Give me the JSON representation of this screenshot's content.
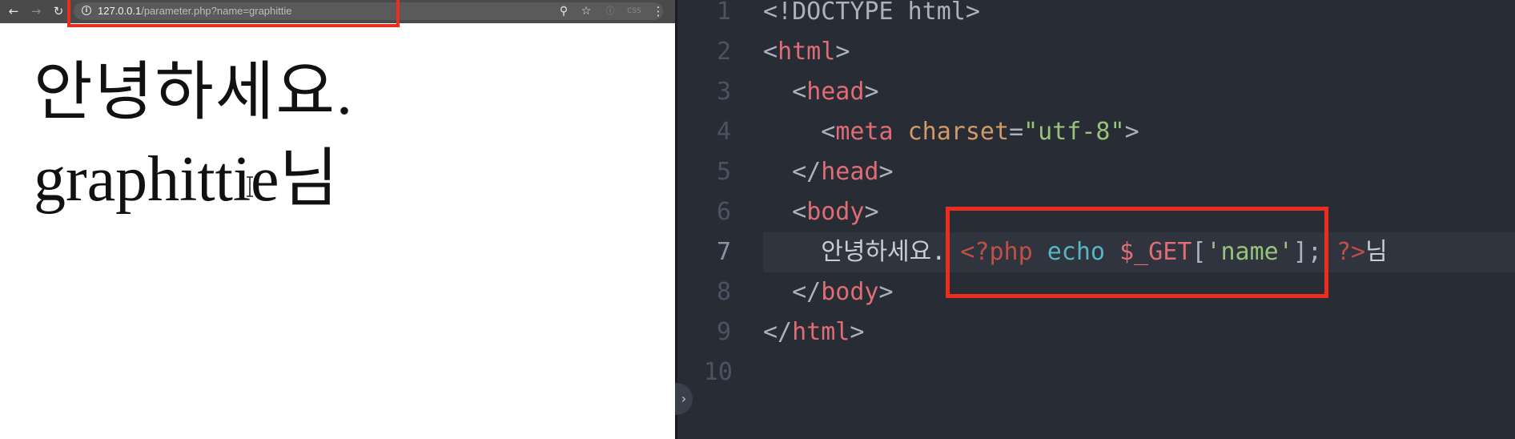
{
  "browser": {
    "url_host": "127.0.0.1",
    "url_path": "/parameter.php?name=graphittie",
    "nav_icons": [
      "back-arrow-icon",
      "forward-arrow-icon",
      "reload-icon"
    ],
    "omnibox_icons": [
      "zoom-icon",
      "star-icon",
      "extension-icon",
      "css-extension-icon",
      "menu-dots-icon"
    ],
    "ext_css_label": "CSS",
    "page": {
      "line1": "안녕하세요.",
      "line2": "graphittie님"
    }
  },
  "editor": {
    "line_numbers": [
      "1",
      "2",
      "3",
      "4",
      "5",
      "6",
      "7",
      "8",
      "9",
      "10"
    ],
    "lines": [
      [
        {
          "t": "<!DOCTYPE html>",
          "c": "t-punc"
        }
      ],
      [
        {
          "t": "<",
          "c": "t-punc"
        },
        {
          "t": "html",
          "c": "t-tag"
        },
        {
          "t": ">",
          "c": "t-punc"
        }
      ],
      [
        {
          "t": "  <",
          "c": "t-punc"
        },
        {
          "t": "head",
          "c": "t-tag"
        },
        {
          "t": ">",
          "c": "t-punc"
        }
      ],
      [
        {
          "t": "    <",
          "c": "t-punc"
        },
        {
          "t": "meta",
          "c": "t-tag"
        },
        {
          "t": " ",
          "c": "t-punc"
        },
        {
          "t": "charset",
          "c": "t-attr"
        },
        {
          "t": "=",
          "c": "t-punc"
        },
        {
          "t": "\"utf-8\"",
          "c": "t-str"
        },
        {
          "t": ">",
          "c": "t-punc"
        }
      ],
      [
        {
          "t": "  </",
          "c": "t-punc"
        },
        {
          "t": "head",
          "c": "t-tag"
        },
        {
          "t": ">",
          "c": "t-punc"
        }
      ],
      [
        {
          "t": "  <",
          "c": "t-punc"
        },
        {
          "t": "body",
          "c": "t-tag"
        },
        {
          "t": ">",
          "c": "t-punc"
        }
      ],
      [
        {
          "t": "    안녕하세요. ",
          "c": "t-text"
        },
        {
          "t": "<?php",
          "c": "t-php"
        },
        {
          "t": " ",
          "c": "t-punc"
        },
        {
          "t": "echo",
          "c": "t-fn"
        },
        {
          "t": " ",
          "c": "t-punc"
        },
        {
          "t": "$_GET",
          "c": "t-var"
        },
        {
          "t": "[",
          "c": "t-punc"
        },
        {
          "t": "'name'",
          "c": "t-str"
        },
        {
          "t": "]; ",
          "c": "t-punc"
        },
        {
          "t": "?>",
          "c": "t-php"
        },
        {
          "t": "님",
          "c": "t-text"
        }
      ],
      [
        {
          "t": "  </",
          "c": "t-punc"
        },
        {
          "t": "body",
          "c": "t-tag"
        },
        {
          "t": ">",
          "c": "t-punc"
        }
      ],
      [
        {
          "t": "</",
          "c": "t-punc"
        },
        {
          "t": "html",
          "c": "t-tag"
        },
        {
          "t": ">",
          "c": "t-punc"
        }
      ],
      []
    ],
    "active_line": 7,
    "toggle_icon": "chevron-right-icon"
  },
  "colors": {
    "highlight_box": "#ec2d1d",
    "editor_bg": "#282c34"
  }
}
